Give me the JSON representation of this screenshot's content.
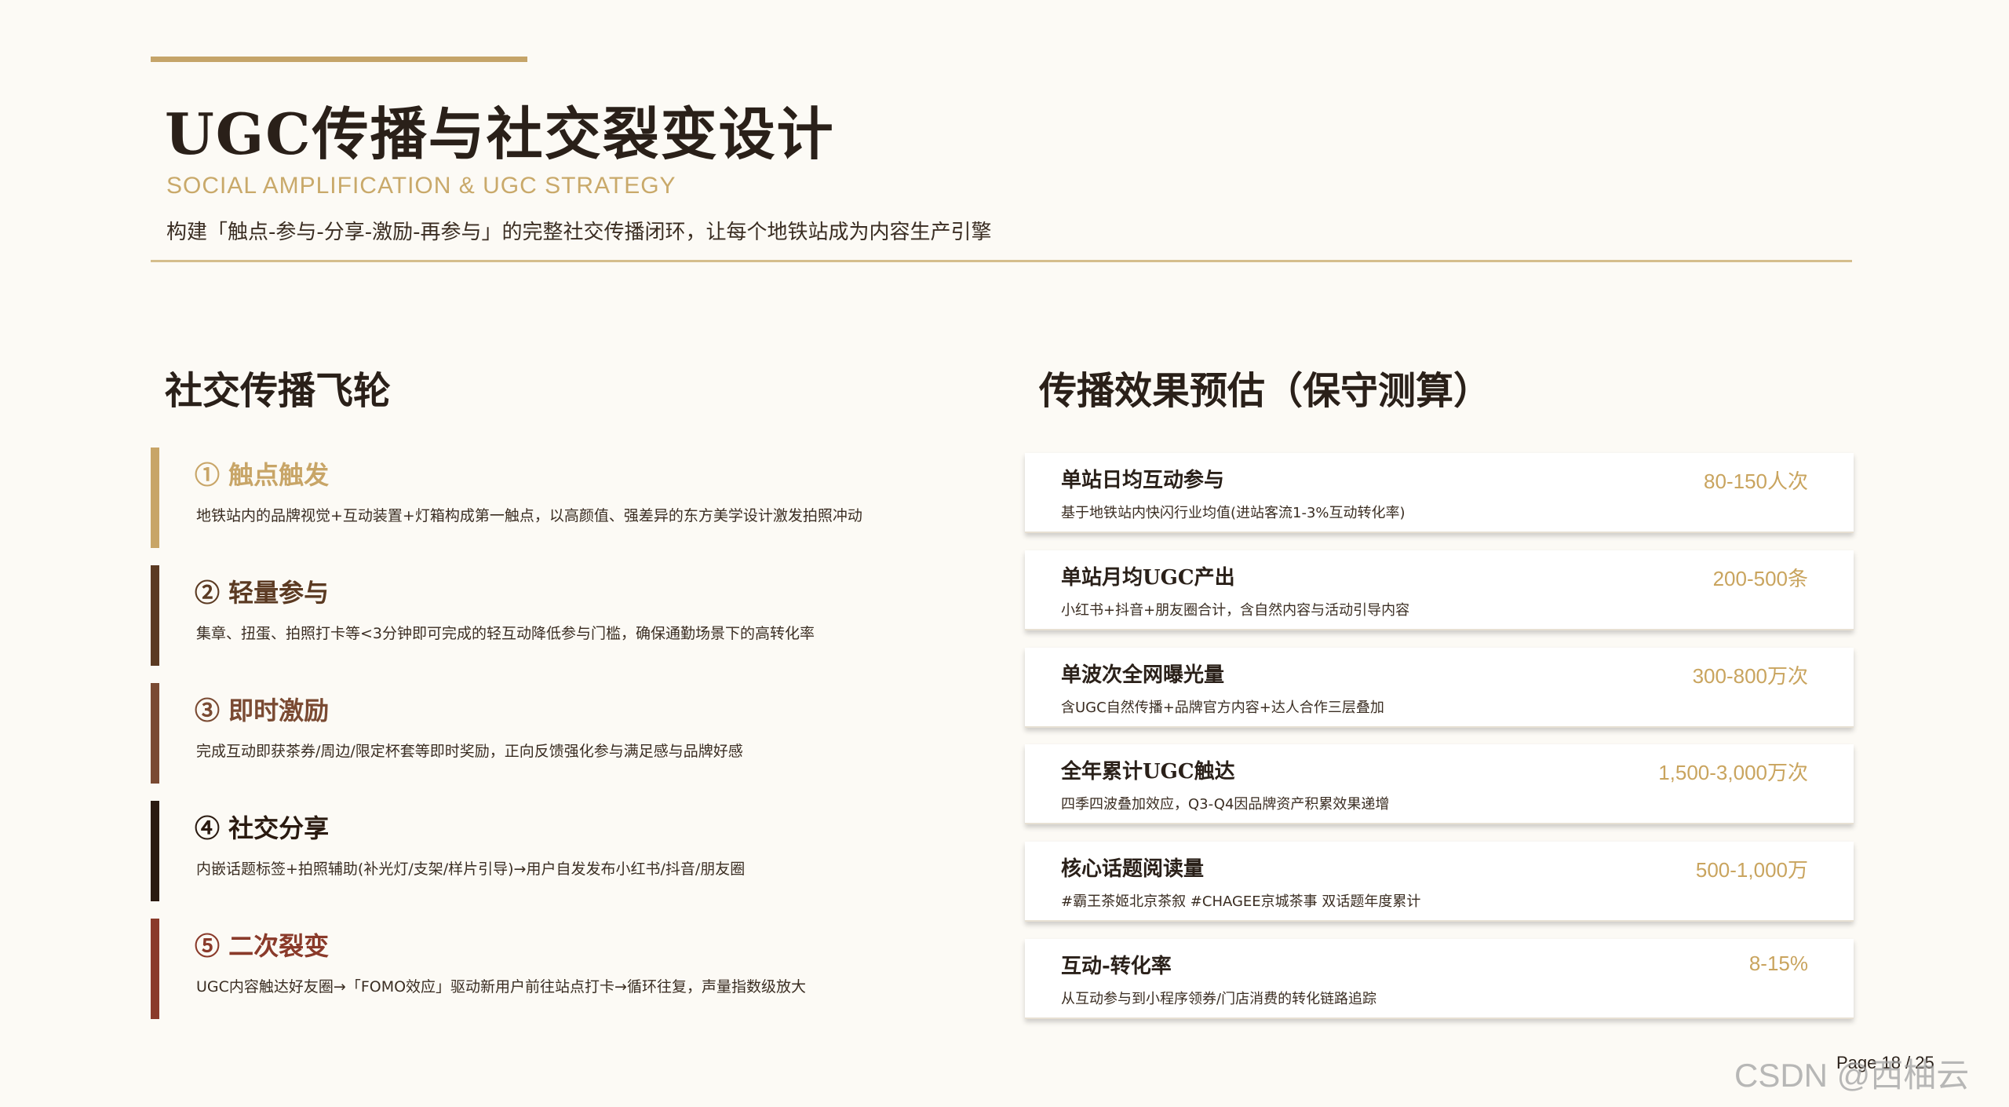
{
  "header": {
    "title": "UGC传播与社交裂变设计",
    "subtitle_en": "SOCIAL AMPLIFICATION & UGC STRATEGY",
    "subtitle_cn": "构建「触点-参与-分享-激励-再参与」的完整社交传播闭环，让每个地铁站成为内容生产引擎"
  },
  "left": {
    "title": "社交传播飞轮",
    "steps": [
      {
        "title": "① 触点触发",
        "desc": "地铁站内的品牌视觉+互动装置+灯箱构成第一触点，以高颜值、强差异的东方美学设计激发拍照冲动",
        "color": "#c8a567"
      },
      {
        "title": "② 轻量参与",
        "desc": "集章、扭蛋、拍照打卡等<3分钟即可完成的轻互动降低参与门槛，确保通勤场景下的高转化率",
        "color": "#5b3a22"
      },
      {
        "title": "③ 即时激励",
        "desc": "完成互动即获茶券/周边/限定杯套等即时奖励，正向反馈强化参与满足感与品牌好感",
        "color": "#7a4a32"
      },
      {
        "title": "④ 社交分享",
        "desc": "内嵌话题标签+拍照辅助(补光灯/支架/样片引导)→用户自发发布小红书/抖音/朋友圈",
        "color": "#2a1a10"
      },
      {
        "title": "⑤ 二次裂变",
        "desc": "UGC内容触达好友圈→「FOMO效应」驱动新用户前往站点打卡→循环往复，声量指数级放大",
        "color": "#8a3a2a"
      }
    ]
  },
  "right": {
    "title": "传播效果预估（保守测算）",
    "cards": [
      {
        "title": "单站日均互动参与",
        "desc": "基于地铁站内快闪行业均值(进站客流1-3%互动转化率)",
        "value": "80-150人次"
      },
      {
        "title": "单站月均UGC产出",
        "desc": "小红书+抖音+朋友圈合计，含自然内容与活动引导内容",
        "value": "200-500条"
      },
      {
        "title": "单波次全网曝光量",
        "desc": "含UGC自然传播+品牌官方内容+达人合作三层叠加",
        "value": "300-800万次"
      },
      {
        "title": "全年累计UGC触达",
        "desc": "四季四波叠加效应，Q3-Q4因品牌资产积累效果递增",
        "value": "1,500-3,000万次"
      },
      {
        "title": "核心话题阅读量",
        "desc": "#霸王茶姬北京茶叙 #CHAGEE京城茶事 双话题年度累计",
        "value": "500-1,000万"
      },
      {
        "title": "互动-转化率",
        "desc": "从互动参与到小程序领券/门店消费的转化链路追踪",
        "value": "8-15%"
      }
    ]
  },
  "footer": {
    "page": "Page 18 / 25",
    "watermark": "CSDN @西柚云"
  }
}
